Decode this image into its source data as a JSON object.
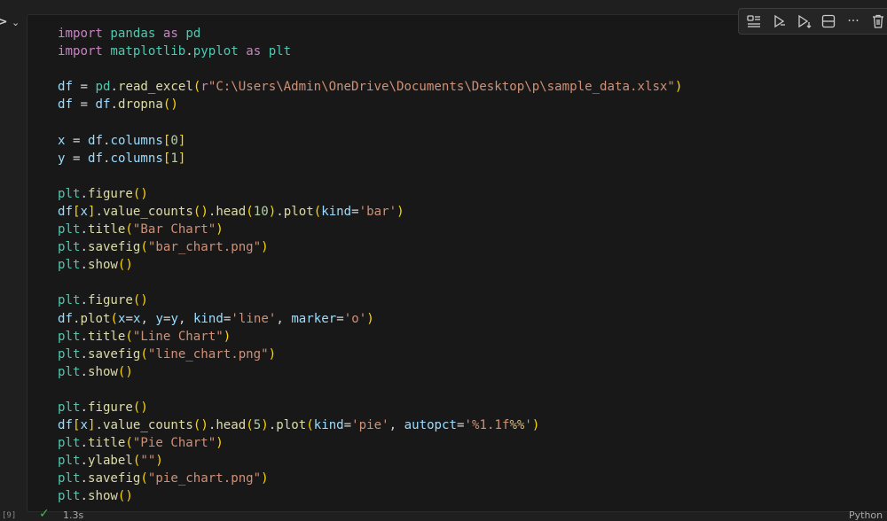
{
  "cell": {
    "run_glyph": ">",
    "chevron_glyph": "⌄",
    "execution_count": "[9]",
    "duration": "1.3s",
    "language": "Python",
    "status_color": "#3fb950"
  },
  "toolbar": {
    "icons": [
      "execute-above-icon",
      "run-cell-icon",
      "run-below-icon",
      "split-cell-icon",
      "more-icon",
      "delete-icon"
    ],
    "more_glyph": "···"
  },
  "code": {
    "lines": [
      "import pandas as pd",
      "import matplotlib.pyplot as plt",
      "",
      "df = pd.read_excel(r\"C:\\Users\\Admin\\OneDrive\\Documents\\Desktop\\p\\sample_data.xlsx\")",
      "df = df.dropna()",
      "",
      "x = df.columns[0]",
      "y = df.columns[1]",
      "",
      "plt.figure()",
      "df[x].value_counts().head(10).plot(kind='bar')",
      "plt.title(\"Bar Chart\")",
      "plt.savefig(\"bar_chart.png\")",
      "plt.show()",
      "",
      "plt.figure()",
      "df.plot(x=x, y=y, kind='line', marker='o')",
      "plt.title(\"Line Chart\")",
      "plt.savefig(\"line_chart.png\")",
      "plt.show()",
      "",
      "plt.figure()",
      "df[x].value_counts().head(5).plot(kind='pie', autopct='%1.1f%%')",
      "plt.title(\"Pie Chart\")",
      "plt.ylabel(\"\")",
      "plt.savefig(\"pie_chart.png\")",
      "plt.show()"
    ]
  }
}
